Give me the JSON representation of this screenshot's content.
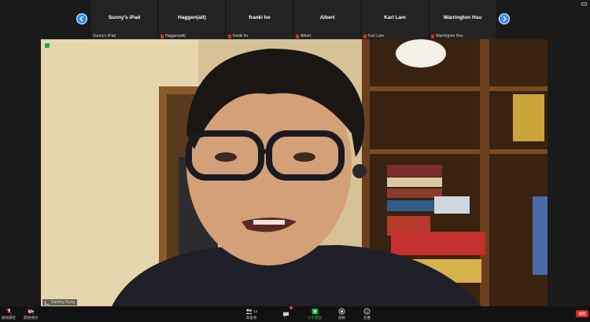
{
  "participants": [
    {
      "name_center": "Sunny's iPad",
      "label": "Sunny's iPad",
      "muted": false
    },
    {
      "name_center": "Haggen(alt)",
      "label": "Haggen(alt)",
      "muted": true
    },
    {
      "name_center": "franki ho",
      "label": "franki ho",
      "muted": true
    },
    {
      "name_center": "Albert",
      "label": "Albert",
      "muted": true
    },
    {
      "name_center": "Karl Lam",
      "label": "Karl Lam",
      "muted": true
    },
    {
      "name_center": "Warrington Hsu",
      "label": "Warrington Hsu",
      "muted": true
    }
  ],
  "main_video": {
    "speaker_label": "Sammy Kung"
  },
  "toolbar": {
    "mute": "解除靜音",
    "start_video": "開啟視訊",
    "participants": "與會者",
    "participants_count": "13",
    "chat": "聊天",
    "chat_badge": "1",
    "share": "分享畫面",
    "record": "錄製",
    "reactions": "反應",
    "end": "離開"
  },
  "colors": {
    "accent": "#2d8cff",
    "share_green": "#1fb141",
    "end_red": "#e02828",
    "background": "#1a1a1a"
  }
}
